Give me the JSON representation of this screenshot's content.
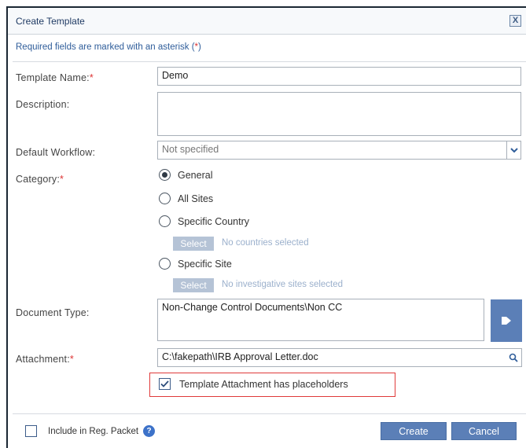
{
  "dialog": {
    "title": "Create Template",
    "close_glyph": "X",
    "required_note": "Required fields are marked with an asterisk (",
    "required_note_star": "*",
    "required_note_end": ")"
  },
  "form": {
    "template_name": {
      "label": "Template Name:",
      "required_mark": "*",
      "value": "Demo"
    },
    "description": {
      "label": "Description:",
      "value": ""
    },
    "default_workflow": {
      "label": "Default Workflow:",
      "selected": "Not specified"
    },
    "category": {
      "label": "Category:",
      "required_mark": "*",
      "options": [
        {
          "label": "General",
          "checked": true
        },
        {
          "label": "All Sites",
          "checked": false
        },
        {
          "label": "Specific Country",
          "checked": false
        },
        {
          "label": "Specific Site",
          "checked": false
        }
      ],
      "country_select_label": "Select",
      "country_note": "No countries selected",
      "site_select_label": "Select",
      "site_note": "No investigative sites selected"
    },
    "document_type": {
      "label": "Document Type:",
      "value": "Non-Change Control Documents\\Non CC"
    },
    "attachment": {
      "label": "Attachment:",
      "required_mark": "*",
      "value": "C:\\fakepath\\IRB Approval Letter.doc",
      "placeholders_label": "Template Attachment has placeholders",
      "placeholders_checked": true
    }
  },
  "footer": {
    "include_label": "Include in Reg. Packet",
    "include_checked": false,
    "help_glyph": "?",
    "create_label": "Create",
    "cancel_label": "Cancel"
  },
  "colors": {
    "accent": "#5b7fb7",
    "required": "#dd3333",
    "highlight_border": "#e03a3a"
  }
}
